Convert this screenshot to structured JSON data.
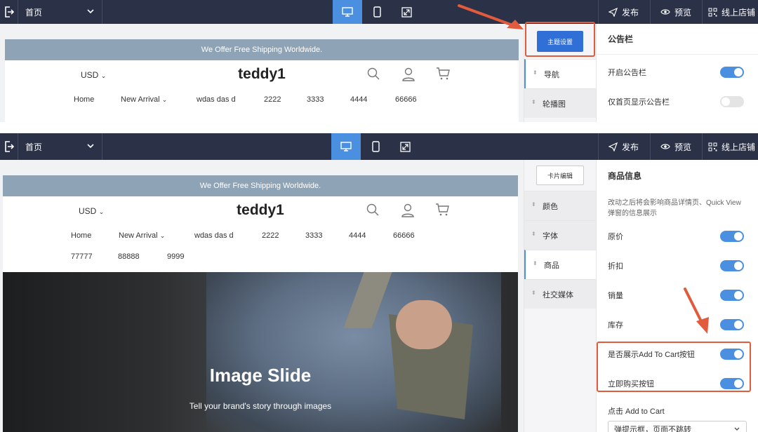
{
  "toolbar": {
    "page_select": "首页",
    "publish_label": "发布",
    "preview_label": "预览",
    "online_store_label": "线上店铺",
    "accent": "#4a8fe0",
    "bg": "#2b3146"
  },
  "storefront": {
    "announcement": "We Offer Free Shipping Worldwide.",
    "currency": "USD",
    "logo": "teddy1",
    "nav_top": [
      "Home",
      "New Arrival",
      "wdas das d",
      "2222",
      "3333",
      "4444",
      "66666"
    ],
    "nav_second_row": [
      "77777",
      "88888",
      "9999"
    ],
    "hero_title": "Image Slide",
    "hero_subtitle": "Tell your brand's story through images"
  },
  "top_panel": {
    "theme_button": "主题设置",
    "sections": [
      "导航",
      "轮播图"
    ],
    "settings_title": "公告栏",
    "settings": [
      {
        "label": "开启公告栏",
        "on": true
      },
      {
        "label": "仅首页显示公告栏",
        "on": false
      }
    ]
  },
  "bottom_panel": {
    "card_edit_button": "卡片编辑",
    "sections": [
      "颜色",
      "字体",
      "商品",
      "社交媒体"
    ],
    "active_section": "商品",
    "settings_title": "商品信息",
    "description": "改动之后将会影响商品详情页、Quick View 弹窗的信息展示",
    "settings": [
      {
        "label": "原价",
        "on": true
      },
      {
        "label": "折扣",
        "on": true
      },
      {
        "label": "销量",
        "on": true
      },
      {
        "label": "库存",
        "on": true
      },
      {
        "label": "是否展示Add To Cart按钮",
        "on": true
      },
      {
        "label": "立即购买按钮",
        "on": true
      }
    ],
    "add_to_cart_label": "点击 Add to Cart",
    "add_to_cart_select": "弹提示框，页面不跳转"
  },
  "highlight_color": "#e15b3c"
}
